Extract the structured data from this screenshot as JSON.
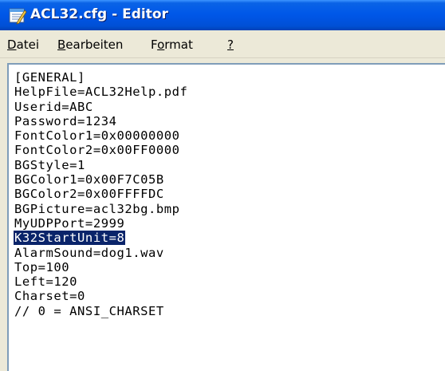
{
  "window": {
    "title": "ACL32.cfg - Editor",
    "icon": "notepad-icon"
  },
  "menu": [
    {
      "label": "Datei",
      "accelerator": "D"
    },
    {
      "label": "Bearbeiten",
      "accelerator": "B"
    },
    {
      "label": "Format",
      "accelerator": "o"
    },
    {
      "label": "?",
      "accelerator": "?"
    }
  ],
  "editor": {
    "lines": [
      "[GENERAL]",
      "HelpFile=ACL32Help.pdf",
      "Userid=ABC",
      "Password=1234",
      "FontColor1=0x00000000",
      "FontColor2=0x00FF0000",
      "BGStyle=1",
      "BGColor1=0x00F7C05B",
      "BGColor2=0x00FFFFDC",
      "BGPicture=acl32bg.bmp",
      "MyUDPPort=2999",
      "K32StartUnit=8",
      "AlarmSound=dog1.wav",
      "Top=100",
      "Left=120",
      "Charset=0",
      "// 0 = ANSI_CHARSET"
    ],
    "selected_line": "K32StartUnit=8"
  },
  "colors": {
    "titlebar": "#0054e3",
    "selection": "#0a246a",
    "window_bg": "#ece9d8"
  }
}
